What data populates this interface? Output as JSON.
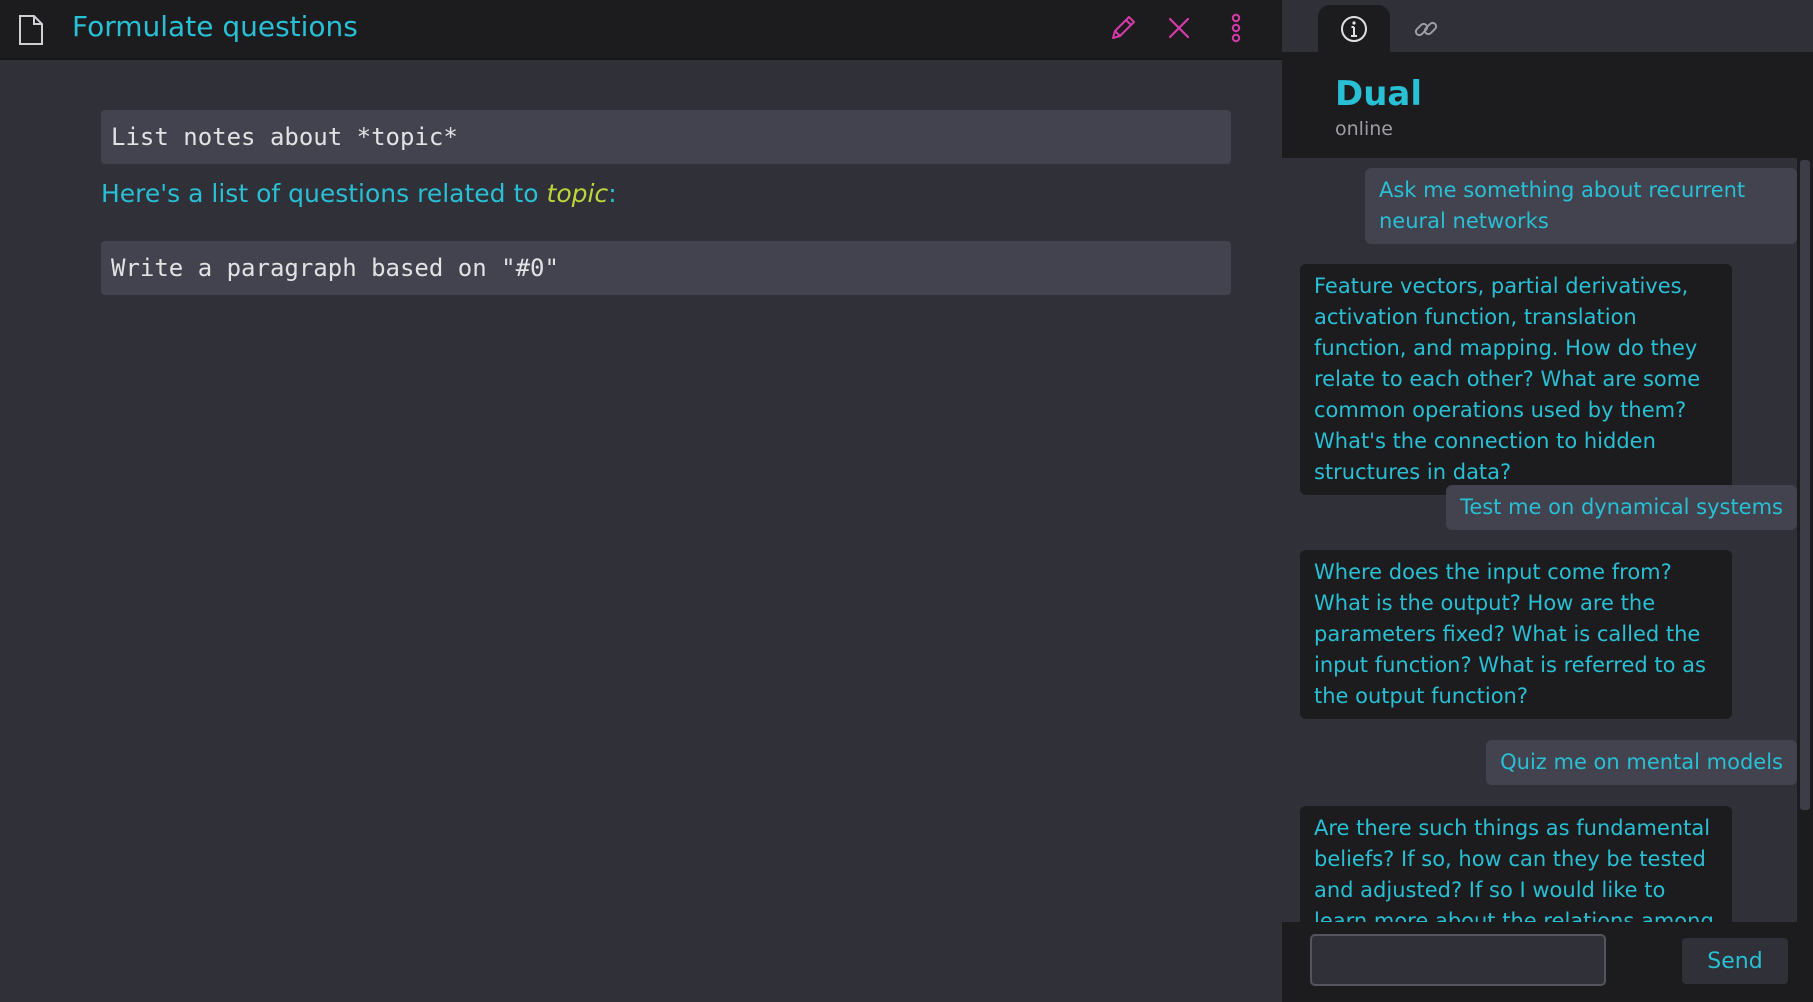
{
  "editor": {
    "title": "Formulate questions",
    "icons": {
      "doc": "document-icon",
      "edit": "pencil-icon",
      "close": "close-icon",
      "more": "more-vertical-icon"
    },
    "blocks": [
      "List notes about *topic*",
      "Write a paragraph based on \"#0\""
    ],
    "rendered": {
      "prefix": "Here's a list of questions related to ",
      "emphasis": "topic",
      "suffix": ":"
    }
  },
  "chat": {
    "tabs": [
      {
        "icon": "info-icon"
      },
      {
        "icon": "link-icon"
      }
    ],
    "title": "Dual",
    "status": "online",
    "messages": [
      {
        "from": "user",
        "text": "Ask me something about recurrent neural networks"
      },
      {
        "from": "bot",
        "text": "Feature vectors, partial derivatives, activation function, translation function, and mapping. How do they relate to each other? What are some common operations used by them? What's the connection to hidden structures in data?"
      },
      {
        "from": "user",
        "text": "Test me on dynamical systems"
      },
      {
        "from": "bot",
        "text": "Where does the input come from? What is the output? How are the parameters fixed? What is called the input function? What is referred to as the output function?"
      },
      {
        "from": "user",
        "text": "Quiz me on mental models"
      },
      {
        "from": "bot",
        "text": "Are there such things as fundamental beliefs? If so, how can they be tested and adjusted? If so I would like to learn more about the relations among them."
      }
    ],
    "input_value": "",
    "send_label": "Send"
  },
  "colors": {
    "accent": "#29bfd4",
    "accent_pink": "#d63aa8",
    "emphasis": "#bfd43a",
    "background": "#2f3038",
    "panel_dark": "#1c1c1e",
    "block_bg": "#42434f"
  }
}
